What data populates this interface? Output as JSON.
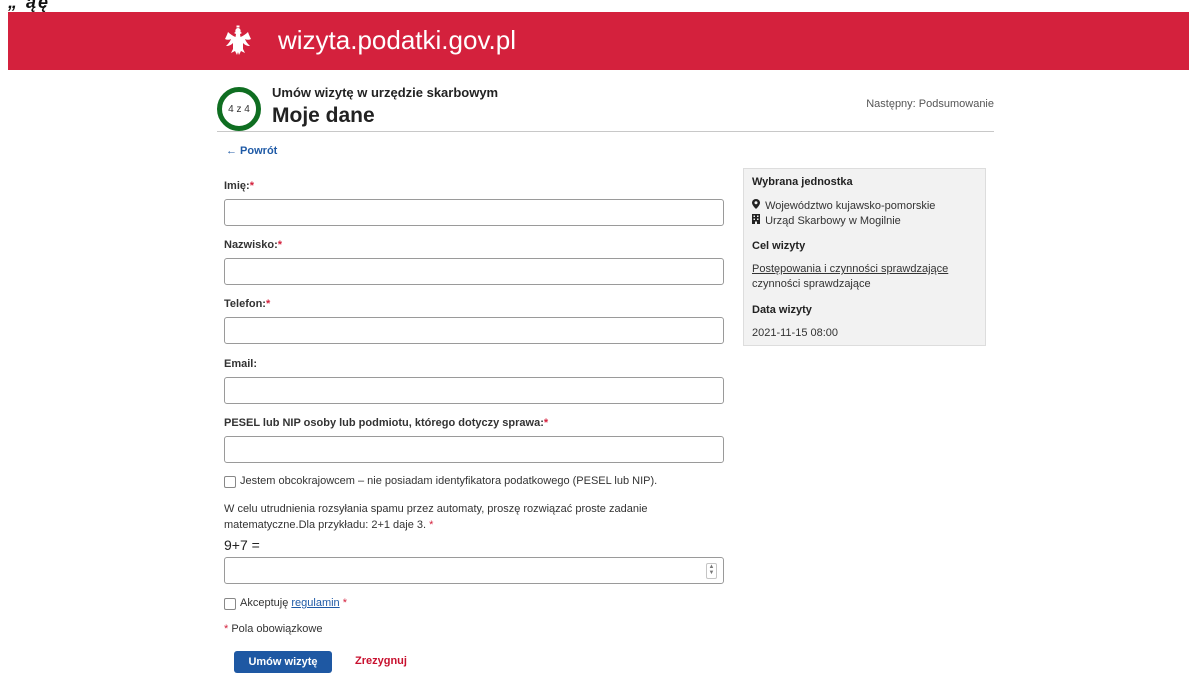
{
  "header": {
    "site_title": "wizyta.podatki.gov.pl",
    "brand_color": "#d4213d",
    "top_fragment": "„       ąę"
  },
  "stepper": {
    "label": "4 z 4",
    "subtitle": "Umów wizytę w urzędzie skarbowym",
    "title": "Moje dane",
    "next": "Następny: Podsumowanie",
    "accent": "#0f6e21"
  },
  "nav": {
    "back": "← Powrót"
  },
  "form": {
    "required_mark": "*",
    "fields": {
      "first_name_label": "Imię:",
      "last_name_label": "Nazwisko:",
      "phone_label": "Telefon:",
      "email_label": "Email:",
      "pesel_label": "PESEL lub NIP osoby lub podmiotu, którego dotyczy sprawa:"
    },
    "foreigner_checkbox": "Jestem obcokrajowcem – nie posiadam identyfikatora podatkowego (PESEL lub NIP).",
    "captcha_line1": "W celu utrudnienia rozsyłania spamu przez automaty, proszę rozwiązać proste zadanie",
    "captcha_line2": "matematyczne.Dla przykładu: 2+1 daje 3.",
    "captcha_equation": "9+7 =",
    "terms_prefix": "Akceptuję",
    "terms_link": "regulamin",
    "required_note": "Pola obowiązkowe",
    "submit": "Umów wizytę",
    "cancel": "Zrezygnuj"
  },
  "summary": {
    "unit_heading": "Wybrana jednostka",
    "voivodeship": "Województwo kujawsko-pomorskie",
    "office": "Urząd Skarbowy w Mogilnie",
    "purpose_heading": "Cel wizyty",
    "purpose_link": "Postępowania i czynności sprawdzające",
    "purpose_detail": "czynności sprawdzające",
    "date_heading": "Data wizyty",
    "date_value": "2021-11-15 08:00"
  }
}
